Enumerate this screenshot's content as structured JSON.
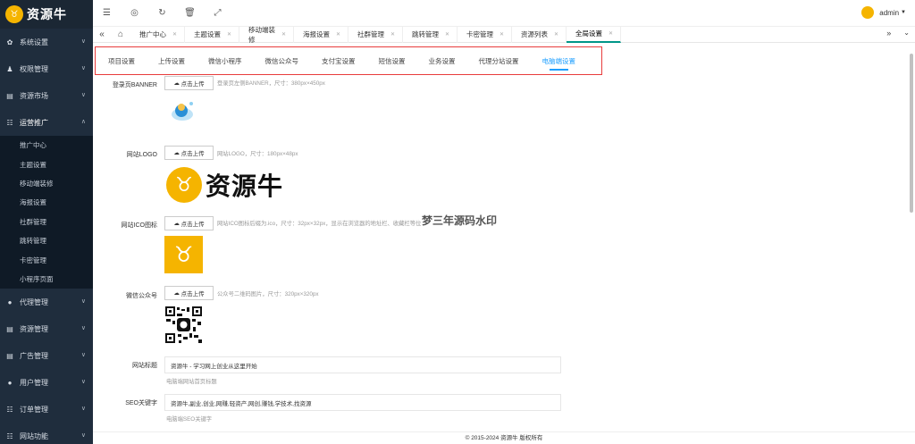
{
  "brand": {
    "name": "资源牛"
  },
  "sidebar": {
    "items_top": [
      {
        "label": "系统设置",
        "icon": "gear-icon"
      },
      {
        "label": "权限管理",
        "icon": "users-icon"
      },
      {
        "label": "资源市场",
        "icon": "document-icon"
      },
      {
        "label": "运营推广",
        "icon": "list-icon"
      }
    ],
    "sub_items": [
      "推广中心",
      "主题设置",
      "移动端装修",
      "海报设置",
      "社群管理",
      "跳转管理",
      "卡密管理",
      "小程序页面"
    ],
    "items_bottom": [
      {
        "label": "代理管理",
        "icon": "user-icon"
      },
      {
        "label": "资源管理",
        "icon": "document-icon"
      },
      {
        "label": "广告管理",
        "icon": "document-icon"
      },
      {
        "label": "用户管理",
        "icon": "user-icon"
      },
      {
        "label": "订单管理",
        "icon": "list-icon"
      },
      {
        "label": "网站功能",
        "icon": "list-icon"
      }
    ]
  },
  "topbar": {
    "user": "admin"
  },
  "tabs": [
    "推广中心",
    "主题设置",
    "移动端装修",
    "海报设置",
    "社群管理",
    "跳转管理",
    "卡密管理",
    "资源列表",
    "全局设置"
  ],
  "settings_tabs": [
    "项目设置",
    "上传设置",
    "微信小程序",
    "微信公众号",
    "支付宝设置",
    "短信设置",
    "业务设置",
    "代理分站设置",
    "电脑端设置"
  ],
  "form": {
    "upload_label": "点击上传",
    "banner": {
      "label": "登录页BANNER",
      "hint": "登录页左侧BANNER，尺寸：380px×450px"
    },
    "logo": {
      "label": "网站LOGO",
      "hint": "网站LOGO，尺寸：180px×48px"
    },
    "ico": {
      "label": "网站ICO图标",
      "hint": "网站ICO图标后缀为.ico，尺寸：32px×32px，显示在浏览器的地址栏、收藏栏等位"
    },
    "wechat": {
      "label": "微信公众号",
      "hint": "公众号二维码图片，尺寸：320px×320px"
    },
    "site_title": {
      "label": "网站标题",
      "value": "资源牛 - 学习网上创业从这里开始",
      "hint": "电脑端网站首页标题"
    },
    "seo_keywords": {
      "label": "SEO关键字",
      "value": "资源牛,副业,创业,网赚,轻资产,网创,赚钱,学技术,找资源",
      "hint": "电脑端SEO关键字"
    }
  },
  "watermark": "梦三年源码水印",
  "footer": "© 2015-2024 资源牛 版权所有"
}
